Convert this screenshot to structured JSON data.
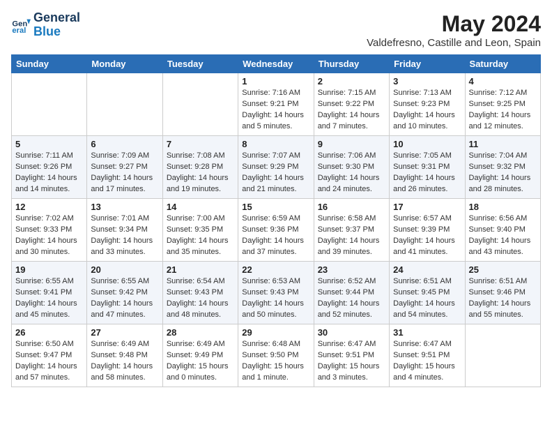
{
  "header": {
    "logo_line1": "General",
    "logo_line2": "Blue",
    "month_title": "May 2024",
    "location": "Valdefresno, Castille and Leon, Spain"
  },
  "weekdays": [
    "Sunday",
    "Monday",
    "Tuesday",
    "Wednesday",
    "Thursday",
    "Friday",
    "Saturday"
  ],
  "weeks": [
    [
      {
        "day": "",
        "sunrise": "",
        "sunset": "",
        "daylight": ""
      },
      {
        "day": "",
        "sunrise": "",
        "sunset": "",
        "daylight": ""
      },
      {
        "day": "",
        "sunrise": "",
        "sunset": "",
        "daylight": ""
      },
      {
        "day": "1",
        "sunrise": "Sunrise: 7:16 AM",
        "sunset": "Sunset: 9:21 PM",
        "daylight": "Daylight: 14 hours and 5 minutes."
      },
      {
        "day": "2",
        "sunrise": "Sunrise: 7:15 AM",
        "sunset": "Sunset: 9:22 PM",
        "daylight": "Daylight: 14 hours and 7 minutes."
      },
      {
        "day": "3",
        "sunrise": "Sunrise: 7:13 AM",
        "sunset": "Sunset: 9:23 PM",
        "daylight": "Daylight: 14 hours and 10 minutes."
      },
      {
        "day": "4",
        "sunrise": "Sunrise: 7:12 AM",
        "sunset": "Sunset: 9:25 PM",
        "daylight": "Daylight: 14 hours and 12 minutes."
      }
    ],
    [
      {
        "day": "5",
        "sunrise": "Sunrise: 7:11 AM",
        "sunset": "Sunset: 9:26 PM",
        "daylight": "Daylight: 14 hours and 14 minutes."
      },
      {
        "day": "6",
        "sunrise": "Sunrise: 7:09 AM",
        "sunset": "Sunset: 9:27 PM",
        "daylight": "Daylight: 14 hours and 17 minutes."
      },
      {
        "day": "7",
        "sunrise": "Sunrise: 7:08 AM",
        "sunset": "Sunset: 9:28 PM",
        "daylight": "Daylight: 14 hours and 19 minutes."
      },
      {
        "day": "8",
        "sunrise": "Sunrise: 7:07 AM",
        "sunset": "Sunset: 9:29 PM",
        "daylight": "Daylight: 14 hours and 21 minutes."
      },
      {
        "day": "9",
        "sunrise": "Sunrise: 7:06 AM",
        "sunset": "Sunset: 9:30 PM",
        "daylight": "Daylight: 14 hours and 24 minutes."
      },
      {
        "day": "10",
        "sunrise": "Sunrise: 7:05 AM",
        "sunset": "Sunset: 9:31 PM",
        "daylight": "Daylight: 14 hours and 26 minutes."
      },
      {
        "day": "11",
        "sunrise": "Sunrise: 7:04 AM",
        "sunset": "Sunset: 9:32 PM",
        "daylight": "Daylight: 14 hours and 28 minutes."
      }
    ],
    [
      {
        "day": "12",
        "sunrise": "Sunrise: 7:02 AM",
        "sunset": "Sunset: 9:33 PM",
        "daylight": "Daylight: 14 hours and 30 minutes."
      },
      {
        "day": "13",
        "sunrise": "Sunrise: 7:01 AM",
        "sunset": "Sunset: 9:34 PM",
        "daylight": "Daylight: 14 hours and 33 minutes."
      },
      {
        "day": "14",
        "sunrise": "Sunrise: 7:00 AM",
        "sunset": "Sunset: 9:35 PM",
        "daylight": "Daylight: 14 hours and 35 minutes."
      },
      {
        "day": "15",
        "sunrise": "Sunrise: 6:59 AM",
        "sunset": "Sunset: 9:36 PM",
        "daylight": "Daylight: 14 hours and 37 minutes."
      },
      {
        "day": "16",
        "sunrise": "Sunrise: 6:58 AM",
        "sunset": "Sunset: 9:37 PM",
        "daylight": "Daylight: 14 hours and 39 minutes."
      },
      {
        "day": "17",
        "sunrise": "Sunrise: 6:57 AM",
        "sunset": "Sunset: 9:39 PM",
        "daylight": "Daylight: 14 hours and 41 minutes."
      },
      {
        "day": "18",
        "sunrise": "Sunrise: 6:56 AM",
        "sunset": "Sunset: 9:40 PM",
        "daylight": "Daylight: 14 hours and 43 minutes."
      }
    ],
    [
      {
        "day": "19",
        "sunrise": "Sunrise: 6:55 AM",
        "sunset": "Sunset: 9:41 PM",
        "daylight": "Daylight: 14 hours and 45 minutes."
      },
      {
        "day": "20",
        "sunrise": "Sunrise: 6:55 AM",
        "sunset": "Sunset: 9:42 PM",
        "daylight": "Daylight: 14 hours and 47 minutes."
      },
      {
        "day": "21",
        "sunrise": "Sunrise: 6:54 AM",
        "sunset": "Sunset: 9:43 PM",
        "daylight": "Daylight: 14 hours and 48 minutes."
      },
      {
        "day": "22",
        "sunrise": "Sunrise: 6:53 AM",
        "sunset": "Sunset: 9:43 PM",
        "daylight": "Daylight: 14 hours and 50 minutes."
      },
      {
        "day": "23",
        "sunrise": "Sunrise: 6:52 AM",
        "sunset": "Sunset: 9:44 PM",
        "daylight": "Daylight: 14 hours and 52 minutes."
      },
      {
        "day": "24",
        "sunrise": "Sunrise: 6:51 AM",
        "sunset": "Sunset: 9:45 PM",
        "daylight": "Daylight: 14 hours and 54 minutes."
      },
      {
        "day": "25",
        "sunrise": "Sunrise: 6:51 AM",
        "sunset": "Sunset: 9:46 PM",
        "daylight": "Daylight: 14 hours and 55 minutes."
      }
    ],
    [
      {
        "day": "26",
        "sunrise": "Sunrise: 6:50 AM",
        "sunset": "Sunset: 9:47 PM",
        "daylight": "Daylight: 14 hours and 57 minutes."
      },
      {
        "day": "27",
        "sunrise": "Sunrise: 6:49 AM",
        "sunset": "Sunset: 9:48 PM",
        "daylight": "Daylight: 14 hours and 58 minutes."
      },
      {
        "day": "28",
        "sunrise": "Sunrise: 6:49 AM",
        "sunset": "Sunset: 9:49 PM",
        "daylight": "Daylight: 15 hours and 0 minutes."
      },
      {
        "day": "29",
        "sunrise": "Sunrise: 6:48 AM",
        "sunset": "Sunset: 9:50 PM",
        "daylight": "Daylight: 15 hours and 1 minute."
      },
      {
        "day": "30",
        "sunrise": "Sunrise: 6:47 AM",
        "sunset": "Sunset: 9:51 PM",
        "daylight": "Daylight: 15 hours and 3 minutes."
      },
      {
        "day": "31",
        "sunrise": "Sunrise: 6:47 AM",
        "sunset": "Sunset: 9:51 PM",
        "daylight": "Daylight: 15 hours and 4 minutes."
      },
      {
        "day": "",
        "sunrise": "",
        "sunset": "",
        "daylight": ""
      }
    ]
  ]
}
